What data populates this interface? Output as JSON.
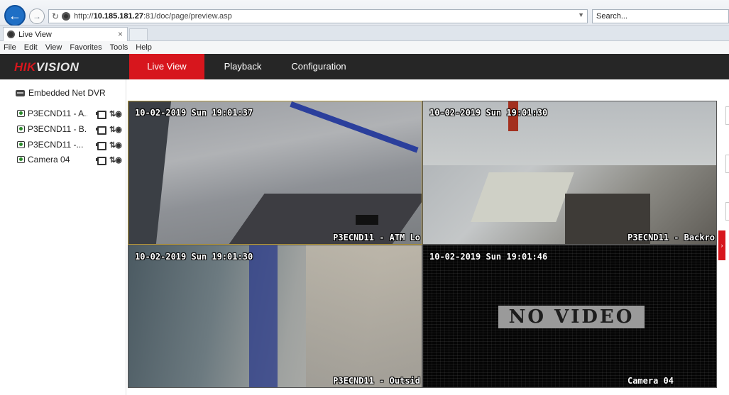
{
  "browser": {
    "url_prefix": "http://",
    "url_host": "10.185.181.27",
    "url_rest": ":81/doc/page/preview.asp",
    "search_placeholder": "Search...",
    "tab_title": "Live View",
    "tab_close": "×",
    "menu": [
      "File",
      "Edit",
      "View",
      "Favorites",
      "Tools",
      "Help"
    ]
  },
  "app": {
    "logo_red": "HIK",
    "logo_rest": "VISION",
    "nav": [
      "Live View",
      "Playback",
      "Configuration"
    ],
    "active_nav": "Live View"
  },
  "sidebar": {
    "device": "Embedded Net DVR",
    "cameras": [
      {
        "label": "P3ECND11 - A..."
      },
      {
        "label": "P3ECND11 - B..."
      },
      {
        "label": "P3ECND11 -..."
      },
      {
        "label": "Camera 04"
      }
    ]
  },
  "tiles": [
    {
      "timestamp": "10-02-2019 Sun 19:01:37",
      "name": "P3ECND11 - ATM Lo",
      "selected": true
    },
    {
      "timestamp": "10-02-2019 Sun 19:01:30",
      "name": "P3ECND11 - Backro",
      "selected": false
    },
    {
      "timestamp": "10-02-2019 Sun 19:01:30",
      "name": "P3ECND11 - Outsid",
      "selected": false
    },
    {
      "timestamp": "10-02-2019 Sun 19:01:46",
      "name": "Camera 04",
      "selected": false,
      "status": "NO VIDEO"
    }
  ],
  "colors": {
    "brand_red": "#d7161d",
    "header_bg": "#262626"
  }
}
